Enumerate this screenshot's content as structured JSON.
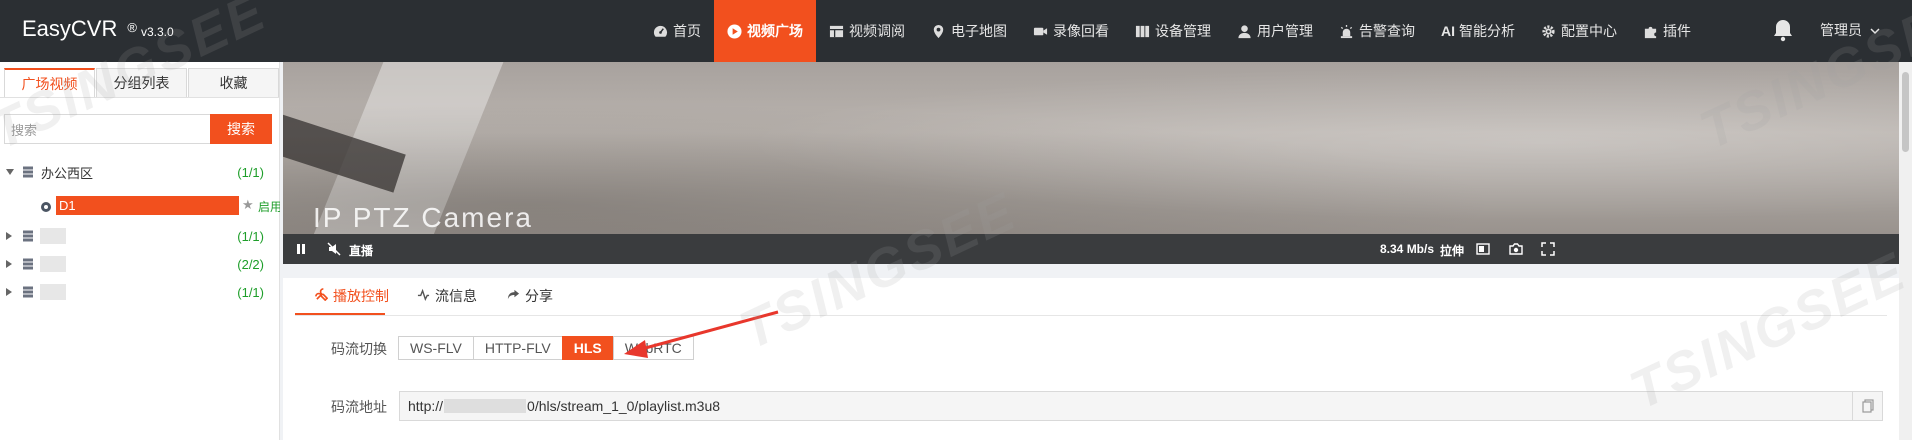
{
  "app": {
    "name": "EasyCVR",
    "reg": "®",
    "version": "v3.3.0"
  },
  "nav": {
    "items": [
      {
        "label": "首页",
        "icon": "dashboard-icon"
      },
      {
        "label": "视频广场",
        "icon": "play-circle-icon",
        "active": true
      },
      {
        "label": "视频调阅",
        "icon": "table-icon"
      },
      {
        "label": "电子地图",
        "icon": "map-pin-icon"
      },
      {
        "label": "录像回看",
        "icon": "video-camera-icon"
      },
      {
        "label": "设备管理",
        "icon": "server-icon"
      },
      {
        "label": "用户管理",
        "icon": "user-icon"
      },
      {
        "label": "告警查询",
        "icon": "siren-icon"
      },
      {
        "label": "智能分析",
        "icon": "ai-icon",
        "prefix": "AI"
      },
      {
        "label": "配置中心",
        "icon": "gear-icon"
      },
      {
        "label": "插件",
        "icon": "puzzle-icon"
      }
    ],
    "user": "管理员"
  },
  "sidebar": {
    "tabs": [
      "广场视频",
      "分组列表",
      "收藏"
    ],
    "search_placeholder": "搜索",
    "search_button": "搜索",
    "groups": [
      {
        "label": "办公西区",
        "count": "(1/1)",
        "expanded": true
      },
      {
        "label": "",
        "count": "(1/1)"
      },
      {
        "label": "",
        "count": "(2/2)"
      },
      {
        "label": "",
        "count": "(1/1)"
      }
    ],
    "camera": {
      "label": "D1",
      "status": "启用"
    }
  },
  "video": {
    "overlay_text": "IP PTZ Camera",
    "live_label": "直播",
    "bitrate": "8.34 Mb/s",
    "stretch_label": "拉伸"
  },
  "panel": {
    "tabs": [
      {
        "label": "播放控制",
        "icon": "tools-icon",
        "active": true
      },
      {
        "label": "流信息",
        "icon": "pulse-icon"
      },
      {
        "label": "分享",
        "icon": "share-icon"
      }
    ],
    "stream_switch_label": "码流切换",
    "stream_options": [
      "WS-FLV",
      "HTTP-FLV",
      "HLS",
      "WebRTC"
    ],
    "stream_selected": "HLS",
    "stream_url_label": "码流地址",
    "stream_url_prefix": "http://",
    "stream_url_suffix": "0/hls/stream_1_0/playlist.m3u8"
  },
  "watermark": "TSINGSEE",
  "colors": {
    "accent": "#f2501e",
    "topbar": "#2b2f33",
    "online": "#1e9e2a"
  }
}
